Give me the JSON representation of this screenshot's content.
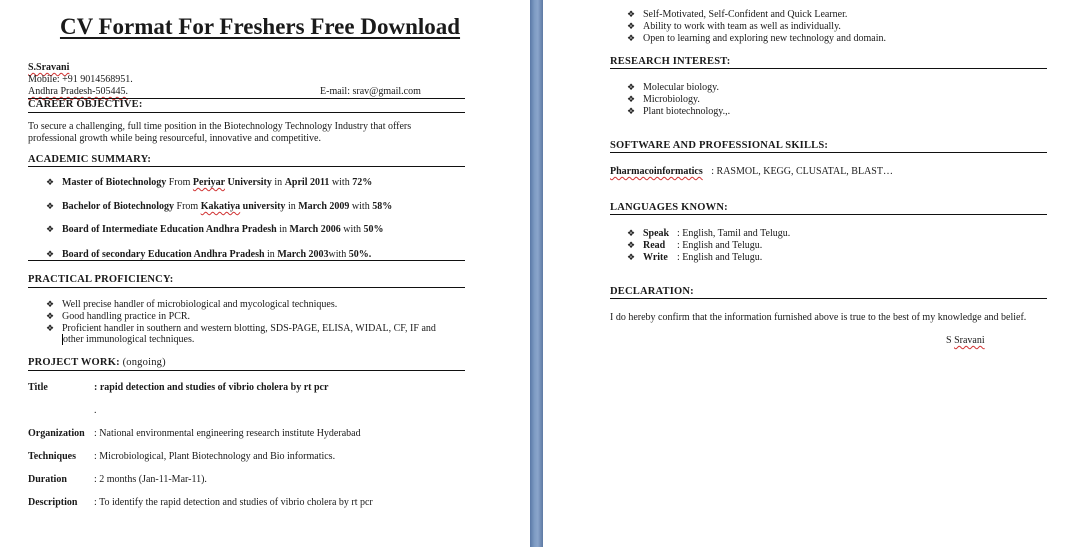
{
  "left_page": {
    "title": "CV Format For Freshers Free Download",
    "contact": {
      "name": "S.Sravani",
      "mobile": "Mobile: +91 9014568951.",
      "address": "Andhra Pradesh-505445.",
      "email": "E-mail: srav@gmail.com"
    },
    "career_objective": {
      "heading": "CAREER OBJECTIVE:",
      "lines": [
        "To secure  a challenging,  full time position in the Biotechnology  Technology  Industry  that offers",
        "professional  growth while being  resourceful,  innovative and  competitive."
      ]
    },
    "academic_summary": {
      "heading": "ACADEMIC SUMMARY:",
      "items": [
        {
          "degree": "Master of Biotechnology",
          "from": " From ",
          "institution": "Periyar",
          "institution2": " University",
          "in": " in ",
          "date": "April 2011",
          "with": " with ",
          "score": "72%"
        },
        {
          "degree": "Bachelor of Biotechnology",
          "from": " From ",
          "institution": "Kakatiya",
          "institution2": " university",
          "in": " in ",
          "date": "March  2009",
          "with": " with ",
          "score": "58%"
        },
        {
          "degree": "Board of Intermediate  Education  Andhra Pradesh",
          "from": "",
          "institution": "",
          "institution2": "",
          "in": "  in ",
          "date": "March  2006",
          "with": " with ",
          "score": "50%"
        },
        {
          "degree": "Board of secondary  Education  Andhra Pradesh",
          "from": "",
          "institution": "",
          "institution2": "",
          "in": "  in ",
          "date": "March  2003",
          "with": "with ",
          "score": "50%."
        }
      ]
    },
    "practical_proficiency": {
      "heading": "PRACTICAL PROFICIENCY:",
      "items": [
        "Well precise  handler of microbiological  and mycological  techniques.",
        "Good handling  practice  in PCR.",
        "Proficient handler in southern and  western  blotting, SDS-PAGE, ELISA,  WIDAL,  CF, IF and"
      ],
      "continuation": "other immunological techniques."
    },
    "project_work": {
      "heading": "PROJECT WORK:",
      "heading_note": " (ongoing)",
      "fields": [
        {
          "label": "Title",
          "value": ": rapid detection  and studies of vibrio cholera  by rt pcr"
        },
        {
          "label": "",
          "value": "."
        },
        {
          "label": "Organization",
          "value": ": National  environmental  engineering  research   institute Hyderabad"
        },
        {
          "label": "Techniques",
          "value": ": Microbiological,  Plant Biotechnology and  Bio informatics."
        },
        {
          "label": "Duration",
          "value": ": 2 months (Jan-11-Mar-11)."
        },
        {
          "label": "Description",
          "value": ": To identify the rapid  detection  and studies of vibrio cholera  by rt pcr"
        }
      ]
    }
  },
  "right_page": {
    "strengths": [
      "Self-Motivated, Self-Confident  and  Quick Learner.",
      "Ability to work with team as well as individually.",
      "Open to learning and exploring new technology and domain."
    ],
    "research_interest": {
      "heading": "RESEARCH INTEREST:",
      "items": [
        "Molecular biology.",
        "Microbiology.",
        "Plant biotechnology.,."
      ]
    },
    "software_skills": {
      "heading": "SOFTWARE AND PROFESSIONAL SKILLS:",
      "label": "Pharmacoinformatics",
      "value": ": RASMOL, KEGG, CLUSATAL, BLAST…"
    },
    "languages": {
      "heading": "LANGUAGES KNOWN:",
      "items": [
        {
          "label": "Speak",
          "value": ": English,  Tamil and Telugu."
        },
        {
          "label": "Read",
          "value": ": English and Telugu."
        },
        {
          "label": "Write",
          "value": ": English and Telugu."
        }
      ]
    },
    "declaration": {
      "heading": "DECLARATION:",
      "text": "I do hereby confirm  that the information  furnished  above is true to the best of my knowledge and belief.",
      "signature_initial": "S ",
      "signature_name": "Sravani"
    }
  },
  "icons": {
    "bullet": "❖"
  },
  "colors": {
    "separator": "#7f9cc4",
    "spellcheck": "#d03030"
  }
}
